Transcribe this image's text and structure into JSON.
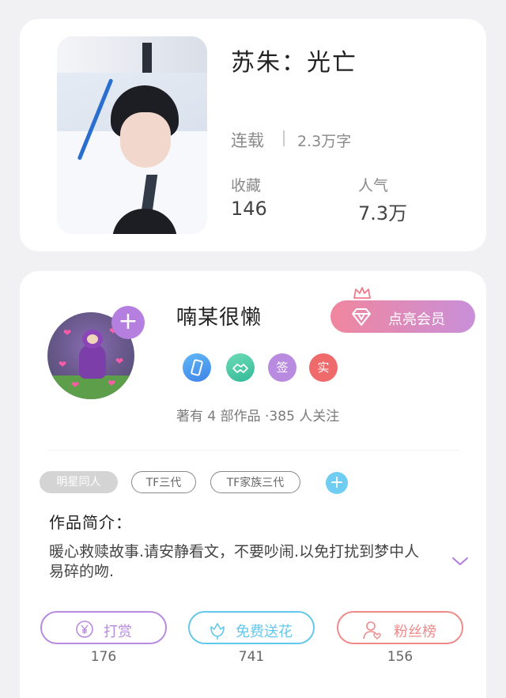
{
  "book": {
    "title": "苏朱：光亡",
    "status": "连载",
    "word_count": "2.3万字",
    "stats": [
      {
        "label": "收藏",
        "value": "146"
      },
      {
        "label": "人气",
        "value": "7.3万"
      }
    ]
  },
  "author": {
    "name": "喃某很懒",
    "add_symbol": "+",
    "vip_button_label": "点亮会员",
    "badges": [
      {
        "icon": "phone-icon",
        "color": "#4a9cf0"
      },
      {
        "icon": "handshake-icon",
        "color": "#3ec8a8"
      },
      {
        "text": "签",
        "color": "#b07fe0"
      },
      {
        "text": "实",
        "color": "#ef6b6b"
      }
    ],
    "meta": "著有 4 部作品 ·385 人关注"
  },
  "tags": [
    {
      "label": "明星同人",
      "style": "filled"
    },
    {
      "label": "TF三代",
      "style": "outline"
    },
    {
      "label": "TF家族三代",
      "style": "outline"
    }
  ],
  "tag_add_symbol": "+",
  "intro": {
    "heading": "作品简介：",
    "text": "暖心救赎故事.请安静看文，不要吵闹.以免打扰到梦中人易碎的吻."
  },
  "actions": [
    {
      "label": "打赏",
      "count": "176",
      "color": "#b98be0",
      "icon": "yen-icon"
    },
    {
      "label": "免费送花",
      "count": "741",
      "color": "#63c8ec",
      "icon": "flower-icon"
    },
    {
      "label": "粉丝榜",
      "count": "156",
      "color": "#ef8a8a",
      "icon": "fan-user-icon"
    }
  ]
}
